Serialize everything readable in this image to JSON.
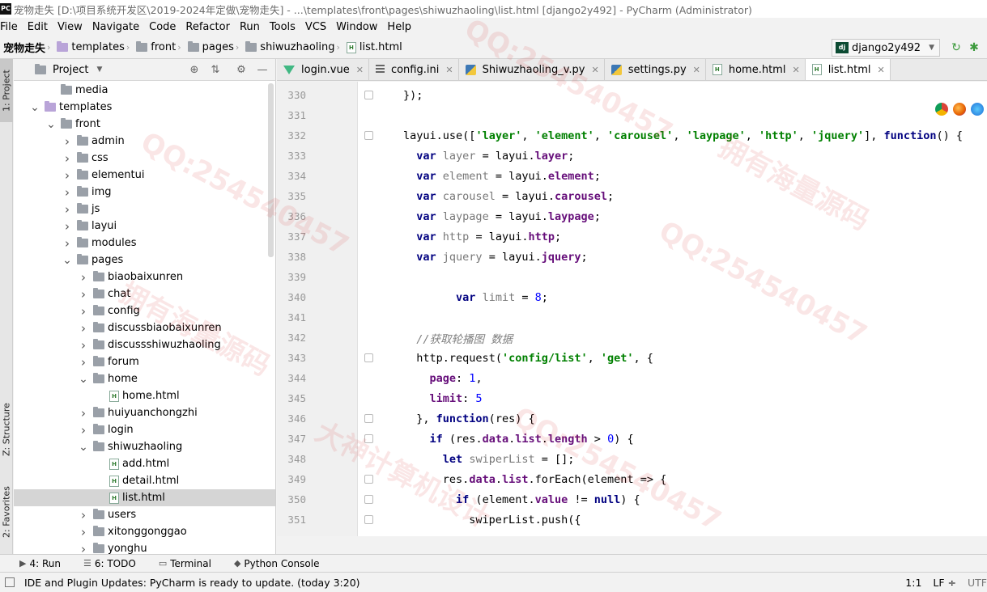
{
  "window": {
    "app_icon_text": "PC",
    "title": "宠物走失 [D:\\项目系统开发区\\2019-2024年定做\\宠物走失] - ...\\templates\\front\\pages\\shiwuzhaoling\\list.html [django2y492] - PyCharm (Administrator)"
  },
  "menu": [
    "File",
    "Edit",
    "View",
    "Navigate",
    "Code",
    "Refactor",
    "Run",
    "Tools",
    "VCS",
    "Window",
    "Help"
  ],
  "breadcrumb": [
    {
      "label": "宠物走失",
      "icon": "folder-icon"
    },
    {
      "label": "templates",
      "icon": "folder-icon"
    },
    {
      "label": "front",
      "icon": "folder-icon"
    },
    {
      "label": "pages",
      "icon": "folder-icon"
    },
    {
      "label": "shiwuzhaoling",
      "icon": "folder-icon"
    },
    {
      "label": "list.html",
      "icon": "html-file-icon"
    }
  ],
  "run_config": {
    "label": "django2y492",
    "icon": "django-icon"
  },
  "left_strip": {
    "project": "1: Project",
    "structure": "Z: Structure",
    "favorites": "2: Favorites"
  },
  "project_panel": {
    "title": "Project",
    "tree": [
      {
        "label": "media",
        "type": "folder",
        "level": 2,
        "arrow": "none"
      },
      {
        "label": "templates",
        "type": "folder-purple",
        "level": 1,
        "arrow": "down"
      },
      {
        "label": "front",
        "type": "folder",
        "level": 2,
        "arrow": "down"
      },
      {
        "label": "admin",
        "type": "folder",
        "level": 3,
        "arrow": "right"
      },
      {
        "label": "css",
        "type": "folder",
        "level": 3,
        "arrow": "right"
      },
      {
        "label": "elementui",
        "type": "folder",
        "level": 3,
        "arrow": "right"
      },
      {
        "label": "img",
        "type": "folder",
        "level": 3,
        "arrow": "right"
      },
      {
        "label": "js",
        "type": "folder",
        "level": 3,
        "arrow": "right"
      },
      {
        "label": "layui",
        "type": "folder",
        "level": 3,
        "arrow": "right"
      },
      {
        "label": "modules",
        "type": "folder",
        "level": 3,
        "arrow": "right"
      },
      {
        "label": "pages",
        "type": "folder",
        "level": 3,
        "arrow": "down"
      },
      {
        "label": "biaobaixunren",
        "type": "folder",
        "level": 4,
        "arrow": "right"
      },
      {
        "label": "chat",
        "type": "folder",
        "level": 4,
        "arrow": "right"
      },
      {
        "label": "config",
        "type": "folder",
        "level": 4,
        "arrow": "right"
      },
      {
        "label": "discussbiaobaixunren",
        "type": "folder",
        "level": 4,
        "arrow": "right"
      },
      {
        "label": "discussshiwuzhaoling",
        "type": "folder",
        "level": 4,
        "arrow": "right"
      },
      {
        "label": "forum",
        "type": "folder",
        "level": 4,
        "arrow": "right"
      },
      {
        "label": "home",
        "type": "folder",
        "level": 4,
        "arrow": "down"
      },
      {
        "label": "home.html",
        "type": "html",
        "level": 5,
        "arrow": "none"
      },
      {
        "label": "huiyuanchongzhi",
        "type": "folder",
        "level": 4,
        "arrow": "right"
      },
      {
        "label": "login",
        "type": "folder",
        "level": 4,
        "arrow": "right"
      },
      {
        "label": "shiwuzhaoling",
        "type": "folder",
        "level": 4,
        "arrow": "down"
      },
      {
        "label": "add.html",
        "type": "html",
        "level": 5,
        "arrow": "none"
      },
      {
        "label": "detail.html",
        "type": "html",
        "level": 5,
        "arrow": "none"
      },
      {
        "label": "list.html",
        "type": "html",
        "level": 5,
        "arrow": "none",
        "selected": true
      },
      {
        "label": "users",
        "type": "folder",
        "level": 4,
        "arrow": "right"
      },
      {
        "label": "xitonggonggao",
        "type": "folder",
        "level": 4,
        "arrow": "right"
      },
      {
        "label": "yonghu",
        "type": "folder",
        "level": 4,
        "arrow": "right"
      }
    ]
  },
  "editor_tabs": [
    {
      "label": "login.vue",
      "icon": "vue-icon",
      "active": false
    },
    {
      "label": "config.ini",
      "icon": "ini-icon",
      "active": false
    },
    {
      "label": "Shiwuzhaoling_v.py",
      "icon": "python-icon",
      "active": false
    },
    {
      "label": "settings.py",
      "icon": "python-icon",
      "active": false
    },
    {
      "label": "home.html",
      "icon": "html-file-icon",
      "active": false
    },
    {
      "label": "list.html",
      "icon": "html-file-icon",
      "active": true
    }
  ],
  "code_lines": [
    {
      "n": "330",
      "text": "});"
    },
    {
      "n": "331",
      "text": ""
    },
    {
      "n": "332",
      "text": "layui.use(['layer', 'element', 'carousel', 'laypage', 'http', 'jquery'], function() {"
    },
    {
      "n": "333",
      "text": "  var layer = layui.layer;"
    },
    {
      "n": "334",
      "text": "  var element = layui.element;"
    },
    {
      "n": "335",
      "text": "  var carousel = layui.carousel;"
    },
    {
      "n": "336",
      "text": "  var laypage = layui.laypage;"
    },
    {
      "n": "337",
      "text": "  var http = layui.http;"
    },
    {
      "n": "338",
      "text": "  var jquery = layui.jquery;"
    },
    {
      "n": "339",
      "text": ""
    },
    {
      "n": "340",
      "text": "        var limit = 8;"
    },
    {
      "n": "341",
      "text": ""
    },
    {
      "n": "342",
      "text": "  //获取轮播图 数据"
    },
    {
      "n": "343",
      "text": "  http.request('config/list', 'get', {"
    },
    {
      "n": "344",
      "text": "    page: 1,"
    },
    {
      "n": "345",
      "text": "    limit: 5"
    },
    {
      "n": "346",
      "text": "  }, function(res) {"
    },
    {
      "n": "347",
      "text": "    if (res.data.list.length > 0) {"
    },
    {
      "n": "348",
      "text": "      let swiperList = [];"
    },
    {
      "n": "349",
      "text": "      res.data.list.forEach(element => {"
    },
    {
      "n": "350",
      "text": "        if (element.value != null) {"
    },
    {
      "n": "351",
      "text": "          swiperList.push({"
    }
  ],
  "bottom_tabs": [
    {
      "label": "4: Run",
      "icon": "run-icon"
    },
    {
      "label": "6: TODO",
      "icon": "todo-icon"
    },
    {
      "label": "Terminal",
      "icon": "terminal-icon"
    },
    {
      "label": "Python Console",
      "icon": "python-console-icon"
    }
  ],
  "status": {
    "message": "IDE and Plugin Updates: PyCharm is ready to update. (today 3:20)",
    "position": "1:1",
    "line_sep": "LF ÷",
    "encoding": "UTF"
  },
  "watermarks": [
    "QQ:254540457",
    "拥有海量源码",
    "大神计算机设计"
  ]
}
